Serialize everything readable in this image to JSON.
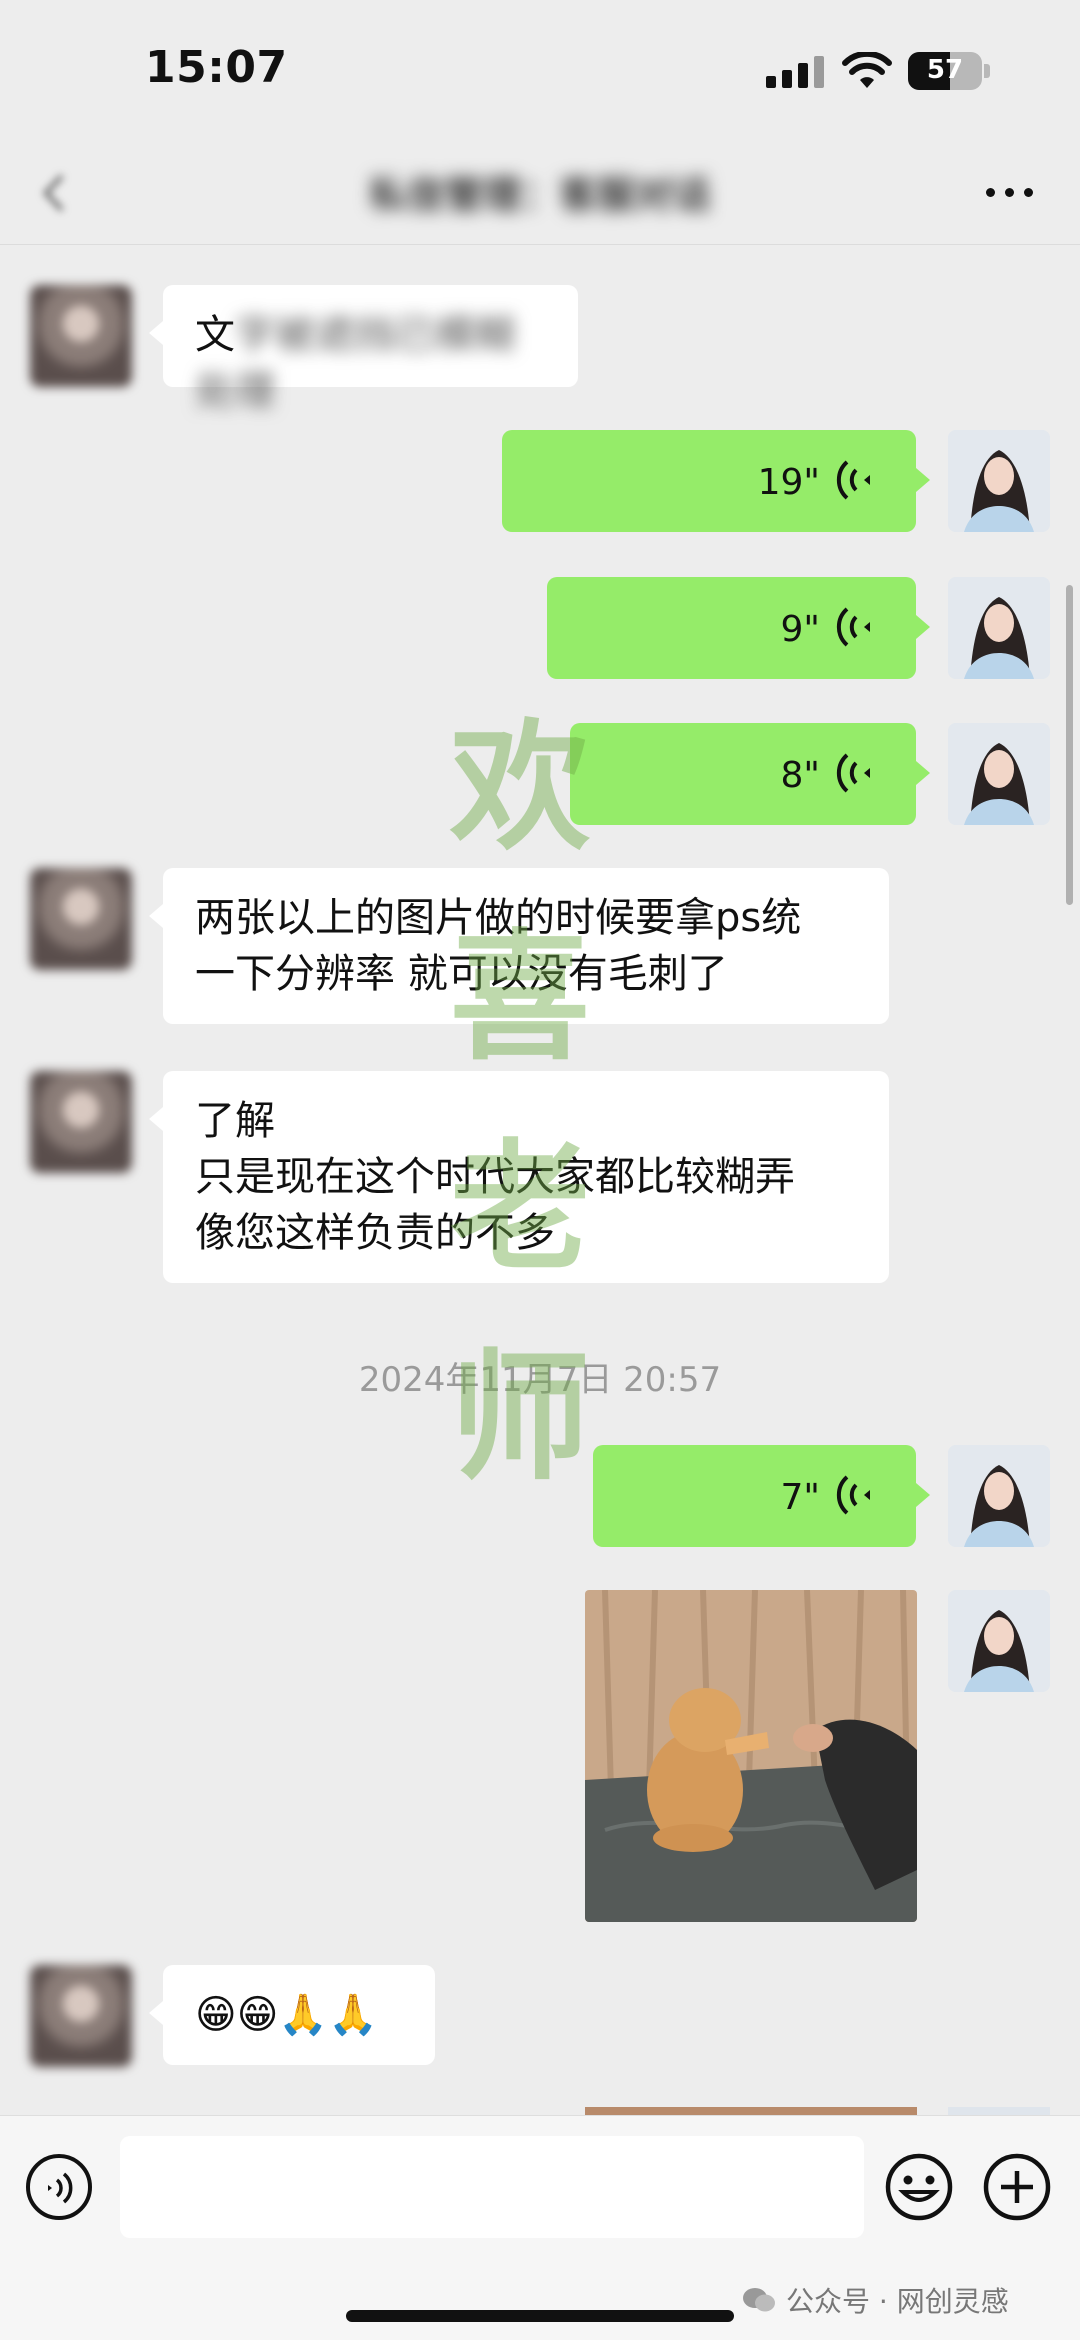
{
  "status_bar": {
    "time": "15:07",
    "battery_level": "57"
  },
  "nav": {
    "title": "私信管理：客服对话",
    "more": "more"
  },
  "messages": [
    {
      "side": "left",
      "text_visible": "文",
      "text_blurred": "字被遮挡已模糊处理"
    },
    {
      "side": "right",
      "duration": "19\""
    },
    {
      "side": "right",
      "duration": "9\""
    },
    {
      "side": "right",
      "duration": "8\""
    },
    {
      "side": "left",
      "lines": [
        "两张以上的图片做的时候要拿ps统",
        "一下分辨率 就可以没有毛刺了"
      ]
    },
    {
      "side": "left",
      "lines": [
        "了解",
        "只是现在这个时代大家都比较糊弄",
        "像您这样负责的不多"
      ]
    },
    {
      "timestamp": "2024年11月7日 20:57"
    },
    {
      "side": "right",
      "duration": "7\""
    },
    {
      "side": "right",
      "image": "cat-photo"
    },
    {
      "side": "left",
      "text": "😁😁🙏🙏"
    }
  ],
  "watermark": [
    "欢",
    "喜",
    "老",
    "师"
  ],
  "input": {
    "placeholder": ""
  },
  "footer": {
    "credit": "公众号 · 网创灵感"
  },
  "colors": {
    "sent_bubble": "#95ec69",
    "received_bubble": "#ffffff",
    "background": "#ededed"
  }
}
